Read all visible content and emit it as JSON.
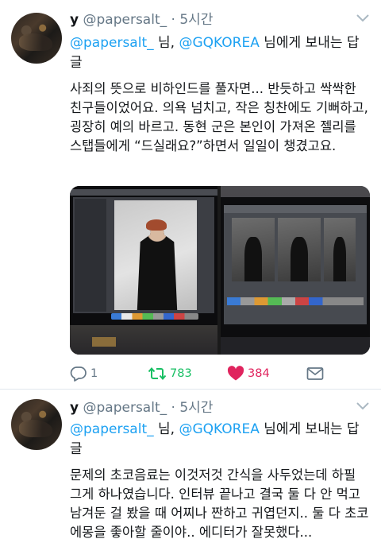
{
  "tweets": [
    {
      "display_name": "y",
      "handle": "@papersalt_",
      "dot": "·",
      "time": "5시간",
      "reply_mention_1": "@papersalt_",
      "reply_sep_1": " 님, ",
      "reply_mention_2": "@GQKOREA",
      "reply_suffix": " 님에게 보내는 답글",
      "text": "사죄의 뜻으로 비하인드를 풀자면... 반듯하고 싹싹한 친구들이었어요. 의욕 넘치고, 작은 칭찬에도 기뻐하고, 굉장히 예의 바르고. 동현 군은 본인이 가져온 젤리를 스탭들에게 “드실래요?”하면서 일일이 챙겼고요.",
      "reply_count": "1",
      "retweet_count": "783",
      "like_count": "384"
    },
    {
      "display_name": "y",
      "handle": "@papersalt_",
      "dot": "·",
      "time": "5시간",
      "reply_mention_1": "@papersalt_",
      "reply_sep_1": " 님, ",
      "reply_mention_2": "@GQKOREA",
      "reply_suffix": " 님에게 보내는 답글",
      "text": "문제의 초코음료는 이것저것 간식을 사두었는데 하필 그게 하나였습니다. 인터뷰 끝나고 결국 둘 다 안 먹고 남겨둔 걸 봤을 때 어찌나 짠하고 귀엽던지.. 둘 다 초코에몽을 좋아할 줄이야.. 에디터가 잘못했다..."
    }
  ],
  "icons": {
    "caret": "chevron-down-icon",
    "reply": "reply-icon",
    "retweet": "retweet-icon",
    "like": "heart-icon",
    "dm": "envelope-icon"
  },
  "colors": {
    "link": "#1da1f2",
    "retweet": "#17bf63",
    "like": "#e0245e",
    "muted": "#657786"
  }
}
